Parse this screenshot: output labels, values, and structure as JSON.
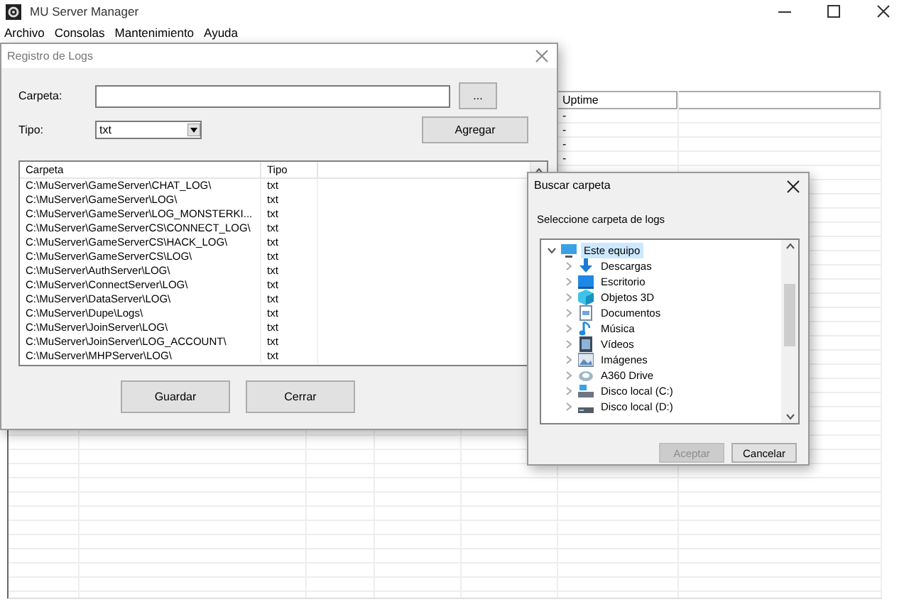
{
  "window": {
    "title": "MU Server Manager"
  },
  "menu": [
    "Archivo",
    "Consolas",
    "Mantenimiento",
    "Ayuda"
  ],
  "server_table": {
    "columns": [
      "Uptime"
    ],
    "rows": [
      "-",
      "-",
      "-",
      "-"
    ]
  },
  "log_dialog": {
    "title": "Registro de Logs",
    "folder_label": "Carpeta:",
    "browse_button": "...",
    "type_label": "Tipo:",
    "type_value": "txt",
    "add_button": "Agregar",
    "columns": [
      "Carpeta",
      "Tipo"
    ],
    "rows": [
      {
        "folder": "C:\\MuServer\\GameServer\\CHAT_LOG\\",
        "type": "txt"
      },
      {
        "folder": "C:\\MuServer\\GameServer\\LOG\\",
        "type": "txt"
      },
      {
        "folder": "C:\\MuServer\\GameServer\\LOG_MONSTERKI...",
        "type": "txt"
      },
      {
        "folder": "C:\\MuServer\\GameServerCS\\CONNECT_LOG\\",
        "type": "txt"
      },
      {
        "folder": "C:\\MuServer\\GameServerCS\\HACK_LOG\\",
        "type": "txt"
      },
      {
        "folder": "C:\\MuServer\\GameServerCS\\LOG\\",
        "type": "txt"
      },
      {
        "folder": "C:\\MuServer\\AuthServer\\LOG\\",
        "type": "txt"
      },
      {
        "folder": "C:\\MuServer\\ConnectServer\\LOG\\",
        "type": "txt"
      },
      {
        "folder": "C:\\MuServer\\DataServer\\LOG\\",
        "type": "txt"
      },
      {
        "folder": "C:\\MuServer\\Dupe\\Logs\\",
        "type": "txt"
      },
      {
        "folder": "C:\\MuServer\\JoinServer\\LOG\\",
        "type": "txt"
      },
      {
        "folder": "C:\\MuServer\\JoinServer\\LOG_ACCOUNT\\",
        "type": "txt"
      },
      {
        "folder": "C:\\MuServer\\MHPServer\\LOG\\",
        "type": "txt"
      }
    ],
    "buttons": [
      "Guardar",
      "Cerrar"
    ]
  },
  "folder_dialog": {
    "title": "Buscar carpeta",
    "prompt": "Seleccione carpeta de logs",
    "tree": [
      {
        "label": "Este equipo",
        "kind": "computer",
        "expanded": true,
        "selected": true,
        "children": [
          {
            "label": "Descargas",
            "kind": "downloads",
            "expanded": false,
            "selected": false
          },
          {
            "label": "Escritorio",
            "kind": "desktop",
            "expanded": false,
            "selected": false
          },
          {
            "label": "Objetos 3D",
            "kind": "cube",
            "expanded": false,
            "selected": false
          },
          {
            "label": "Documentos",
            "kind": "document",
            "expanded": false,
            "selected": false
          },
          {
            "label": "Música",
            "kind": "music",
            "expanded": false,
            "selected": false
          },
          {
            "label": "Vídeos",
            "kind": "video",
            "expanded": false,
            "selected": false
          },
          {
            "label": "Imágenes",
            "kind": "image",
            "expanded": false,
            "selected": false
          },
          {
            "label": "A360 Drive",
            "kind": "cloud",
            "expanded": false,
            "selected": false
          },
          {
            "label": "Disco local (C:)",
            "kind": "system-drive",
            "expanded": false,
            "selected": false
          },
          {
            "label": "Disco local (D:)",
            "kind": "drive",
            "expanded": false,
            "selected": false
          }
        ]
      }
    ],
    "buttons": [
      {
        "label": "Aceptar",
        "disabled": true
      },
      {
        "label": "Cancelar",
        "disabled": false
      }
    ]
  }
}
